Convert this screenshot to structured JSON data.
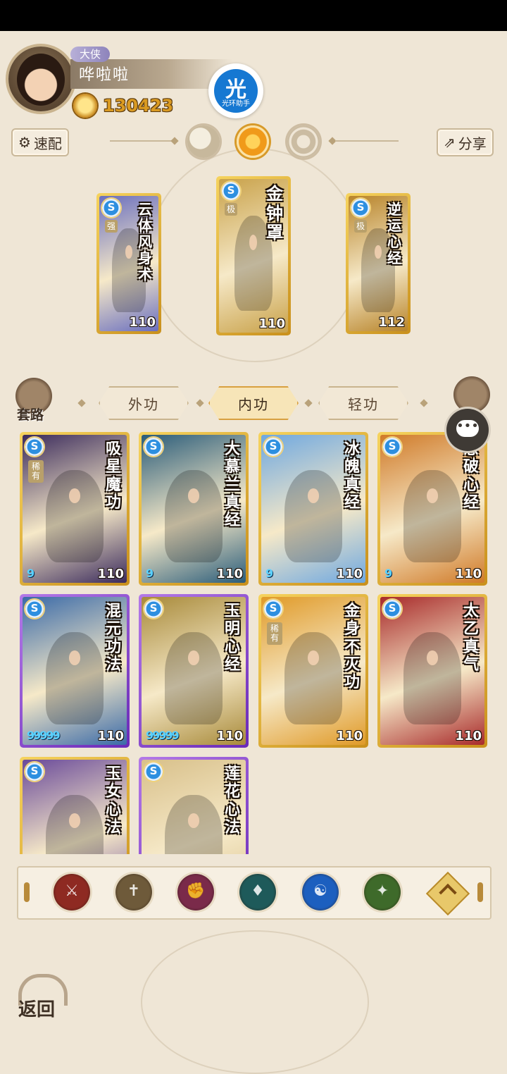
{
  "player": {
    "rank": "大侠",
    "name": "哗啦啦",
    "coins": "130423"
  },
  "helper": {
    "glyph": "光",
    "label": "光环助手"
  },
  "toolbar": {
    "quick_config_label": "速配",
    "share_label": "分享"
  },
  "equipped": [
    {
      "title": "云体风身术",
      "badge": "强",
      "level": "110",
      "theme": "#6a6fbf"
    },
    {
      "title": "金钟罩",
      "badge": "极",
      "level": "110",
      "theme": "#c9a24a"
    },
    {
      "title": "逆运心经",
      "badge": "极",
      "level": "112",
      "theme": "#b8842a"
    }
  ],
  "side_buttons": {
    "left_label": "套路",
    "right_label": ""
  },
  "tabs": [
    {
      "label": "外功",
      "active": false
    },
    {
      "label": "内功",
      "active": true
    },
    {
      "label": "轻功",
      "active": false
    }
  ],
  "cards": [
    {
      "title": "吸星魔功",
      "level": "110",
      "frame": "gold",
      "tag": "稀有",
      "theme": "#3a2a5c",
      "swirls": "9"
    },
    {
      "title": "大慕兰真经",
      "level": "110",
      "frame": "gold",
      "tag": "",
      "theme": "#2a5c7a",
      "swirls": "9"
    },
    {
      "title": "冰魄真经",
      "level": "110",
      "frame": "gold",
      "tag": "",
      "theme": "#6fa8e0",
      "swirls": "9"
    },
    {
      "title": "意破心经",
      "level": "110",
      "frame": "gold",
      "tag": "",
      "theme": "#d07a28",
      "swirls": "9"
    },
    {
      "title": "混元功法",
      "level": "110",
      "frame": "purple",
      "tag": "",
      "theme": "#3a6aa8",
      "swirls": "99999"
    },
    {
      "title": "玉明心经",
      "level": "110",
      "frame": "purple",
      "tag": "",
      "theme": "#a88a3a",
      "swirls": "99999"
    },
    {
      "title": "金身不灭功",
      "level": "110",
      "frame": "gold",
      "tag": "稀有",
      "theme": "#e09a28",
      "swirls": ""
    },
    {
      "title": "太乙真气",
      "level": "110",
      "frame": "gold",
      "tag": "",
      "theme": "#a82a2a",
      "swirls": ""
    },
    {
      "title": "玉女心法",
      "level": "",
      "frame": "gold",
      "tag": "",
      "theme": "#6a4a9a",
      "swirls": ""
    },
    {
      "title": "莲花心法",
      "level": "",
      "frame": "purple",
      "tag": "",
      "theme": "#d8c08a",
      "swirls": ""
    }
  ],
  "schools": [
    {
      "name": "blade-school-icon",
      "color": "#8e2a22"
    },
    {
      "name": "sword-school-icon",
      "color": "#6e5a3a"
    },
    {
      "name": "fist-school-icon",
      "color": "#7a2a4a"
    },
    {
      "name": "fan-school-icon",
      "color": "#1e5a5a"
    },
    {
      "name": "taichi-school-icon",
      "color": "#1c5fbf"
    },
    {
      "name": "staff-school-icon",
      "color": "#3e6a2a"
    },
    {
      "name": "all-school-icon",
      "color": "#e8c86a"
    }
  ],
  "back": {
    "label": "返回"
  }
}
